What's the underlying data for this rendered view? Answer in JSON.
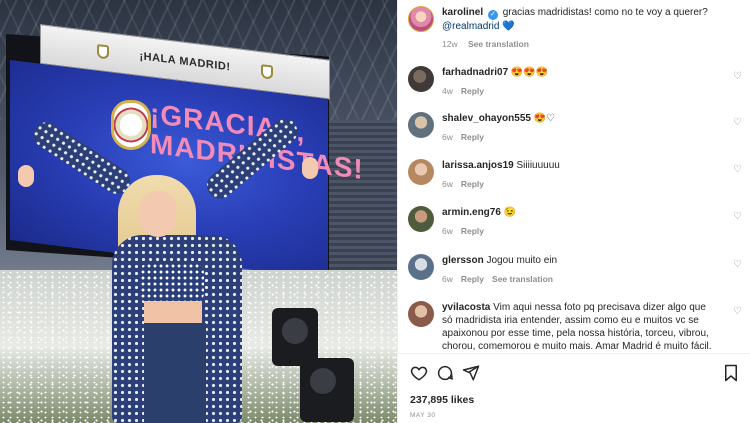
{
  "photo": {
    "banner_text": "¡HALA MADRID!",
    "screen_text_line1": "¡GRACIAS,",
    "screen_text_line2": "MADRIDISTAS!"
  },
  "post": {
    "author": "karolinel",
    "caption": "gracias madridistas! como no te voy a querer?",
    "mention": "@realmadrid",
    "heart": "💙",
    "time": "12w",
    "see_translation": "See translation"
  },
  "comments": [
    {
      "username": "farhadnadri07",
      "text": "😍😍😍",
      "time": "4w",
      "reply": "Reply",
      "see_translation": ""
    },
    {
      "username": "shalev_ohayon555",
      "text": "😍♡",
      "time": "6w",
      "reply": "Reply",
      "see_translation": ""
    },
    {
      "username": "larissa.anjos19",
      "text": "Siiiiuuuuu",
      "time": "6w",
      "reply": "Reply",
      "see_translation": ""
    },
    {
      "username": "armin.eng76",
      "text": "😉",
      "time": "6w",
      "reply": "Reply",
      "see_translation": ""
    },
    {
      "username": "glersson",
      "text": "Jogou muito ein",
      "time": "6w",
      "reply": "Reply",
      "see_translation": "See translation"
    },
    {
      "username": "yvilacosta",
      "text": "Vim aqui nessa foto pq precisava dizer algo que só madridista iria entender, assim como eu e muitos vc se apaixonou por esse time, pela nossa história, torceu, vibrou, chorou, comemorou e muito mais. Amar Madrid é muito fácil.",
      "time": "",
      "reply": "",
      "see_translation": ""
    }
  ],
  "actions": {
    "likes": "237,895 likes",
    "date": "MAY 30"
  },
  "colors": {
    "link": "#00376b",
    "verified": "#3897f0",
    "muted": "#8e8e8e"
  }
}
